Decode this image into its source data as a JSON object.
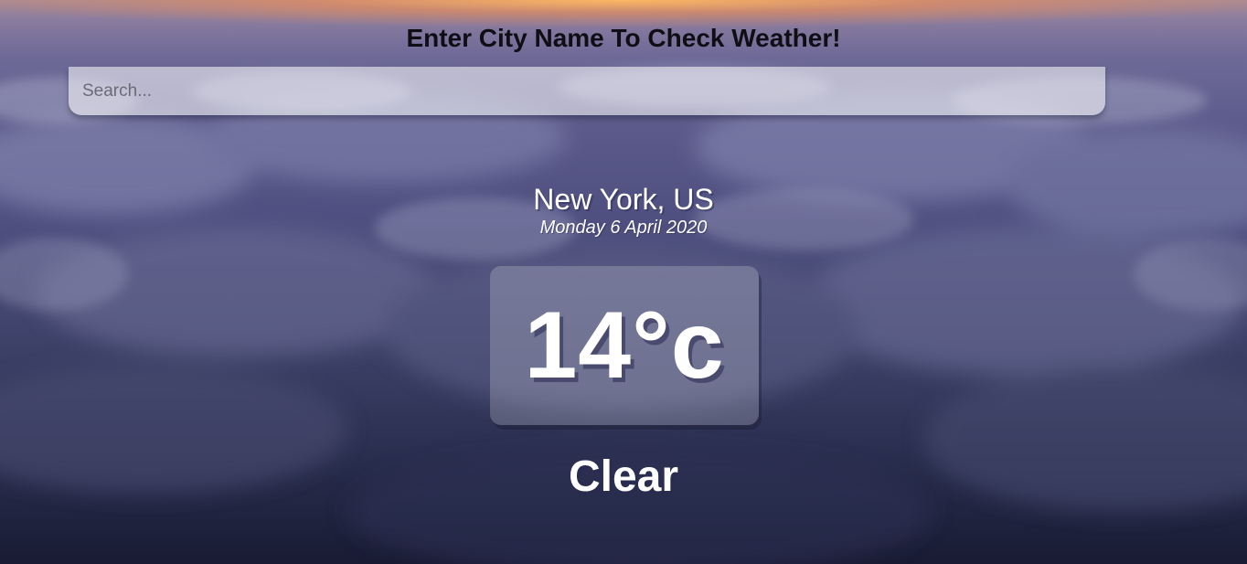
{
  "heading": "Enter City Name To Check Weather!",
  "search": {
    "placeholder": "Search...",
    "value": ""
  },
  "location": {
    "city": "New York, US",
    "date": "Monday 6 April 2020"
  },
  "weather": {
    "temperature": "14°c",
    "condition": "Clear"
  }
}
